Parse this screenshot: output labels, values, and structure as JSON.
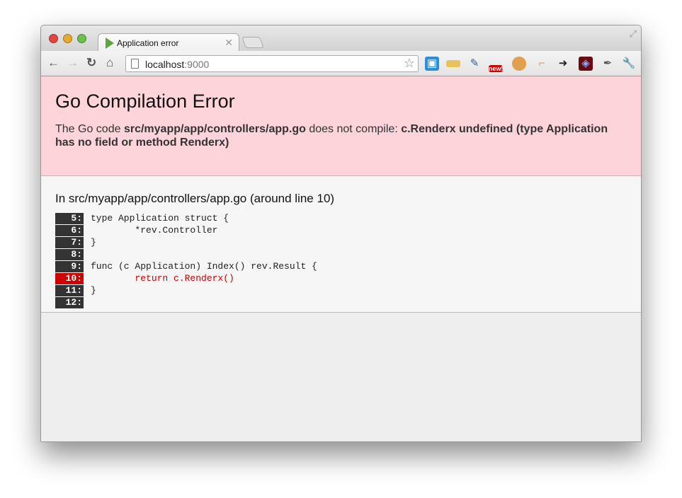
{
  "browser": {
    "tab_title": "Application error",
    "url_host": "localhost",
    "url_port": ":9000",
    "extensions": [
      "screen-capture-icon",
      "ruler-icon",
      "eyedropper-icon",
      "camera-new-icon",
      "cookie-icon",
      "page-ruler-icon",
      "send-to-phone-icon",
      "flow-diagram-icon",
      "pen-tool-icon",
      "wrench-icon"
    ]
  },
  "error": {
    "title": "Go Compilation Error",
    "desc_prefix": "The Go code ",
    "file": "src/myapp/app/controllers/app.go",
    "desc_mid": " does not compile: ",
    "message": "c.Renderx undefined (type Application has no field or method Renderx)"
  },
  "source": {
    "heading": "In src/myapp/app/controllers/app.go (around line 10)",
    "lines": [
      {
        "num": "5:",
        "code": "type Application struct {"
      },
      {
        "num": "6:",
        "code": "        *rev.Controller"
      },
      {
        "num": "7:",
        "code": "}"
      },
      {
        "num": "8:",
        "code": ""
      },
      {
        "num": "9:",
        "code": "func (c Application) Index() rev.Result {"
      },
      {
        "num": "10:",
        "code": "        return c.Renderx()",
        "error": true
      },
      {
        "num": "11:",
        "code": "}"
      },
      {
        "num": "12:",
        "code": ""
      }
    ]
  },
  "colors": {
    "error_bg": "#fdd4da",
    "error_line": "#cc0000"
  }
}
